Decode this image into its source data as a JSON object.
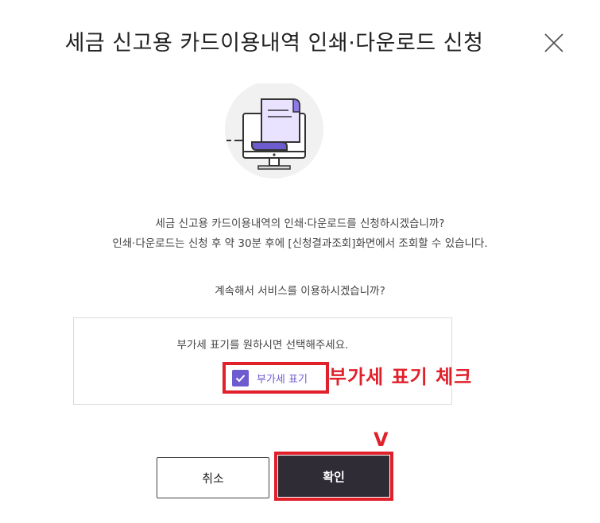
{
  "dialog": {
    "title": "세금 신고용 카드이용내역 인쇄·다운로드 신청",
    "description_line1": "세금 신고용 카드이용내역의 인쇄·다운로드를 신청하시겠습니까?",
    "description_line2": "인쇄·다운로드는 신청 후 약 30분 후에 [신청결과조회]화면에서 조회할 수 있습니다.",
    "confirm_question": "계속해서 서비스를 이용하시겠습니까?"
  },
  "vat": {
    "prompt": "부가세 표기를 원하시면 선택해주세요.",
    "checkbox_label": "부가세 표기",
    "checked": true
  },
  "annotations": {
    "vat_note": "부가세 표기 체크",
    "confirm_mark": "V"
  },
  "buttons": {
    "cancel": "취소",
    "confirm": "확인"
  },
  "icons": {
    "close": "close-icon",
    "illustration": "monitor-document-icon",
    "check": "check-icon"
  },
  "colors": {
    "accent_purple": "#6d5bd0",
    "annotation_red": "#e0202b",
    "confirm_button": "#2f2c36"
  }
}
